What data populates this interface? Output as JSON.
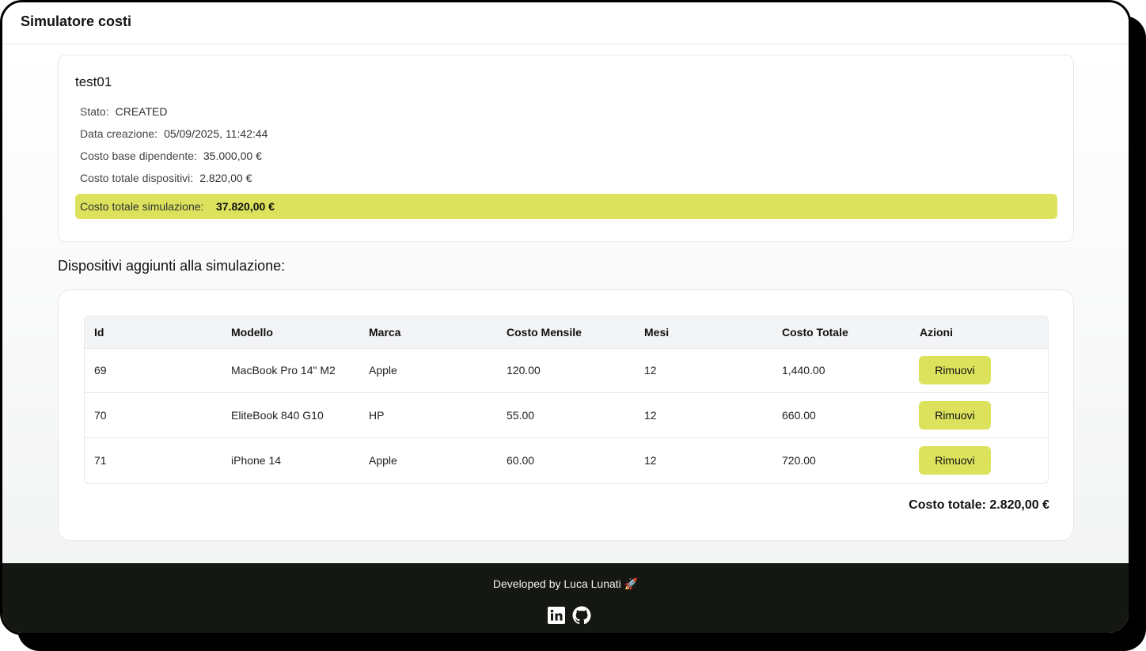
{
  "app": {
    "title": "Simulatore costi"
  },
  "simulation": {
    "name": "test01",
    "fields": [
      {
        "label": "Stato:",
        "value": "CREATED"
      },
      {
        "label": "Data creazione:",
        "value": "05/09/2025, 11:42:44"
      },
      {
        "label": "Costo base dipendente:",
        "value": "35.000,00 €"
      },
      {
        "label": "Costo totale dispositivi:",
        "value": "2.820,00 €"
      }
    ],
    "total": {
      "label": "Costo totale simulazione:",
      "value": "37.820,00 €"
    }
  },
  "devices": {
    "title": "Dispositivi aggiunti alla simulazione:",
    "columns": [
      "Id",
      "Modello",
      "Marca",
      "Costo Mensile",
      "Mesi",
      "Costo Totale",
      "Azioni"
    ],
    "rows": [
      {
        "id": "69",
        "model": "MacBook Pro 14\" M2",
        "brand": "Apple",
        "monthly": "120.00",
        "months": "12",
        "total": "1,440.00",
        "action": "Rimuovi"
      },
      {
        "id": "70",
        "model": "EliteBook 840 G10",
        "brand": "HP",
        "monthly": "55.00",
        "months": "12",
        "total": "660.00",
        "action": "Rimuovi"
      },
      {
        "id": "71",
        "model": "iPhone 14",
        "brand": "Apple",
        "monthly": "60.00",
        "months": "12",
        "total": "720.00",
        "action": "Rimuovi"
      }
    ],
    "grand_total": "Costo totale: 2.820,00 €"
  },
  "footer": {
    "text": "Developed by Luca Lunati 🚀",
    "icons": [
      "linkedin-icon",
      "github-icon"
    ]
  },
  "colors": {
    "accent": "#dce25c",
    "footer_bg": "#141712"
  }
}
